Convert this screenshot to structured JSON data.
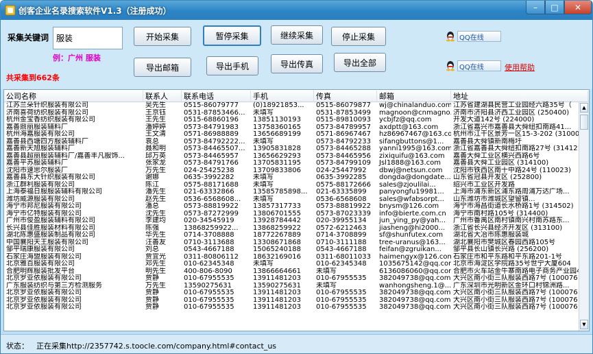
{
  "window": {
    "title": "创客企业名录搜索软件V1.3（注册成功）",
    "min": "–",
    "max": "□",
    "close": "✕"
  },
  "panel": {
    "keyword_label": "采集关键词",
    "keyword_value": "服装",
    "example": "例：广州    服装",
    "count": "共采集到662条",
    "buttons": {
      "start": "开始采集",
      "pause": "暂停采集",
      "resume": "继续采集",
      "stop": "停止采集",
      "export_email": "导出邮箱",
      "export_phone": "导出手机",
      "export_fax": "导出传真",
      "export_all": "导出全部"
    },
    "qq1": "QQ在线",
    "qq2": "QQ在线",
    "help": "使用帮助"
  },
  "table": {
    "columns": [
      "公司名称",
      "联系人",
      "联系电话",
      "手机",
      "传真",
      "邮箱",
      "地址"
    ],
    "rows": [
      [
        "江苏兰朵针织服装有限公司",
        "吴先生",
        "0515-86079777",
        "(0)18921853...",
        "0515-86079877",
        "wj@chinalanduo.com",
        "江苏省建湖县民营工业园经六路35号（"
      ],
      [
        "济南喜荷纺织服装有限公司",
        "王京钰",
        "0531-87853466...",
        "未填写",
        "0531-87853499",
        "magnoon@cnmagno...",
        "济南市济阳县济西工业园区 (250400)"
      ],
      [
        "杭州金宝香纺织服装有限公司",
        "王先生",
        "0515-68860196",
        "13851130193",
        "0515-89810093",
        "ycbjfz@qq.com",
        "开发大道142号 (224000)"
      ],
      [
        "嘉善鼎丽服装辅料厂",
        "潘婷婷",
        "0573-84791983",
        "13758360165",
        "0573-84789957",
        "axdptt@163.com",
        "浙江省嘉兴市嘉善县大舜纽扣南路41..."
      ],
      [
        "杭州海嘉服装有限公司",
        "王文清",
        "0571-86988889",
        "13656689199",
        "0571-86967467",
        "hz86967467@163.com",
        "杭州市江干区景芳一区15-3-202 (310000"
      ],
      [
        "嘉善县西塘四方服装辅料厂",
        "袁总",
        "0573-84792222...",
        "未填写",
        "0573-84792233",
        "sifangbuttons@1...",
        "嘉善县大舜镇新南梅圩"
      ],
      [
        "嘉善新天旭服装辅料厂",
        "聂和明",
        "0573-84465507...",
        "13905831828",
        "0573-84465288",
        "yanni1995@163.com",
        "浙江省嘉善县大舜纽扣南路27号 (314121"
      ],
      [
        "嘉善县超丽服装辅料厂/嘉善丰凡服饰...",
        "邱万英",
        "0573-84465957",
        "13656629293",
        "0573-84465956",
        "zixiquifu@163.com",
        "嘉善大舜工业区横兴西路6号"
      ],
      [
        "嘉善平苏服装辅料厂",
        "张家龙",
        "0573-84791766",
        "13705831195",
        "0573-84799109",
        "Jsl1888@163.com",
        "嘉善县大舜工业园区 (314100)"
      ],
      [
        "沈阳市速思尔服装厂",
        "万先生",
        "024-25425238",
        "13709833806",
        "024-25447992",
        "dbwj@netsun.com",
        "沈阳市铁西区南十中路24号 (110023)"
      ],
      [
        "嘉善县东大针织服装有限公司",
        "谢娜",
        "0635-3992282",
        "未填写",
        "0635-3992285",
        "dongda@dongdate...",
        "山东省冠县开发区 (252800)"
      ],
      [
        "浙江群利服装有限公司",
        "陈江",
        "0575-88171688",
        "未填写",
        "0575-88172666",
        "sales@zjoulilai...",
        "绍兴市工业区开发路"
      ],
      [
        "上海泰福日服服装辅料有限公司",
        "潘先生",
        "021-63332866",
        "13585785898...",
        "021-63335899",
        "panyongfu19981...",
        "上海市浦东新区浦东路周浦万达广场..."
      ],
      [
        "潍坊威源服装有限公司",
        "赵先生",
        "0536-6568608...",
        "未填写",
        "0536-6568608",
        "sales@wfabsorpt...",
        "山东潍坊市潍城区望留镇..."
      ],
      [
        "海宁市邦尼服装有限公司",
        "潘总",
        "0573-88819922",
        "13857317733",
        "0573-88819922",
        "bnysm@126.com",
        "海宁市海昌街道长水桥路1号 (314502)"
      ],
      [
        "海宁市亿特服装有限公司",
        "沈先生",
        "0573-87272999",
        "13806701555",
        "0573-87023339",
        "info@bierte.com.cn",
        "海宁市南村路105号 (314400)"
      ],
      [
        "广州市俊盈服装辅料有限公司",
        "李建均",
        "020-34545919",
        "13928784442",
        "020-39955134",
        "jun_ying_py@yah...",
        "广州市番禺区南村镇南兴村南苏路东..."
      ],
      [
        "长兴县佳胜服装材料有限公司",
        "陈强",
        "13868259922...",
        "13868259922",
        "0572-6212463",
        "jiasheng@hi2000...",
        "浙江省长兴县经济开发区 (313100)"
      ],
      [
        "湖北陈惠盛服装制品有限公司",
        "华先生",
        "0714-3708888",
        "18772267889",
        "0714-3708899",
        "sf@shunfutex.com",
        "湖北省大冶市陈惠服装城"
      ],
      [
        "中国襄阳天王服装有限公司",
        "汪善友",
        "0710-3113688",
        "13308671868",
        "0710-3111188",
        "tree-uranus@163...",
        "湖北襄阳市樊城区春园西路105号"
      ],
      [
        "邹平瑞康服装有限公司",
        "刘总",
        "0543-4667188",
        "15065240188",
        "0543-4667188",
        "feifan@zgruikan...",
        "邹平县长山镇长兴路 (256200)"
      ],
      [
        "石家庄海盟服装有限公司",
        "贾宜光",
        "0311-80806112",
        "18632169016",
        "0311-68011033",
        "haimengyx@126.com",
        "石家庄市和平东路和平东路201-1号"
      ],
      [
        "北京雅百服装有限公司",
        "邓先生",
        "010-62345348",
        "未填写",
        "010-62345348",
        "1035675142@qq.com",
        "北京市海淀区学院路35号世宁大厦604"
      ],
      [
        "合肥明辉服装批发平台",
        "明先生",
        "400-806-8090",
        "13866664661",
        "未填写",
        "6136086060@qq.com",
        "合肥市火车站金牛寨南路电子商务产业园401"
      ],
      [
        "北京罗亚依服装有限公司",
        "贾静",
        "010-67955535",
        "13911481203",
        "010-67955535",
        "382049738@qq.com",
        "大兴区南小街三队服装西路7号 (100076"
      ],
      [
        "广东服装纺织与第三方检测服务",
        "万先生",
        "13590275631",
        "13590275631",
        "未填写",
        "wanhongsheng.1@...",
        "广东深圳市光明新区金环口村锦洲路..."
      ],
      [
        "北京罗亚依服装有限公司",
        "贾静",
        "010-67955535",
        "13911481203",
        "010-67955535",
        "382049738@qq.com",
        "大兴区南小街三队服装西路7号 (100076"
      ],
      [
        "北京罗亚依服装有限公司",
        "贾静",
        "010-67955535",
        "13911481203",
        "010-67955535",
        "382049738@qq.com",
        "大兴区南小街三队服装西路7号 (100076"
      ],
      [
        "北京罗亚依服装有限公司",
        "贾静",
        "010-67955535",
        "13911481203",
        "010-67955535",
        "382049738@qq.com",
        "大兴区南小街三队服装西路7号 (100076"
      ]
    ]
  },
  "status": {
    "label": "状态：",
    "text": "正在采集http://2357742.s.toocle.com/company.html#contact_us"
  }
}
